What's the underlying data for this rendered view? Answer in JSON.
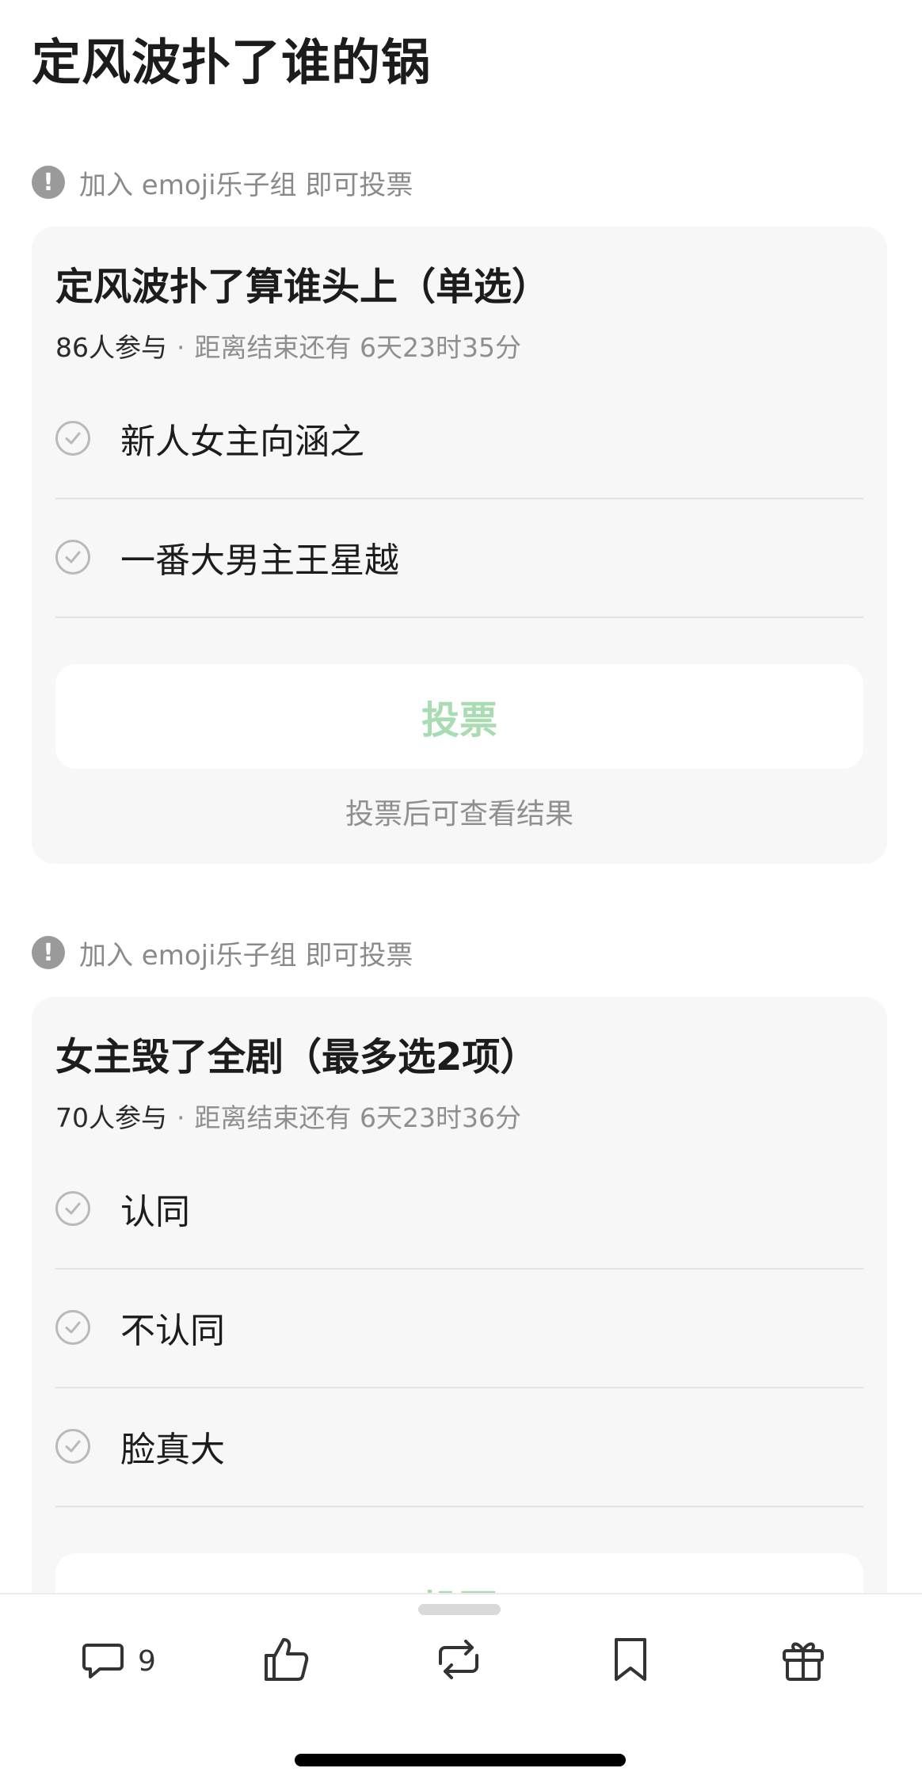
{
  "page": {
    "title": "定风波扑了谁的锅"
  },
  "polls": [
    {
      "notice": "加入 emoji乐子组 即可投票",
      "title": "定风波扑了算谁头上（单选）",
      "participants": "86人参与",
      "meta_separator": "·",
      "deadline": "距离结束还有 6天23时35分",
      "options": [
        "新人女主向涵之",
        "一番大男主王星越"
      ],
      "vote_label": "投票",
      "hint": "投票后可查看结果"
    },
    {
      "notice": "加入 emoji乐子组 即可投票",
      "title": "女主毁了全剧（最多选2项）",
      "participants": "70人参与",
      "meta_separator": "·",
      "deadline": "距离结束还有 6天23时36分",
      "options": [
        "认同",
        "不认同",
        "脸真大"
      ],
      "vote_label": "投票"
    }
  ],
  "bottom_bar": {
    "comment_count": "9",
    "icons": [
      "comment-icon",
      "like-icon",
      "repost-icon",
      "bookmark-icon",
      "gift-icon"
    ]
  },
  "colors": {
    "vote_disabled": "#a9dcb2",
    "card_background": "#f7f7f7"
  }
}
